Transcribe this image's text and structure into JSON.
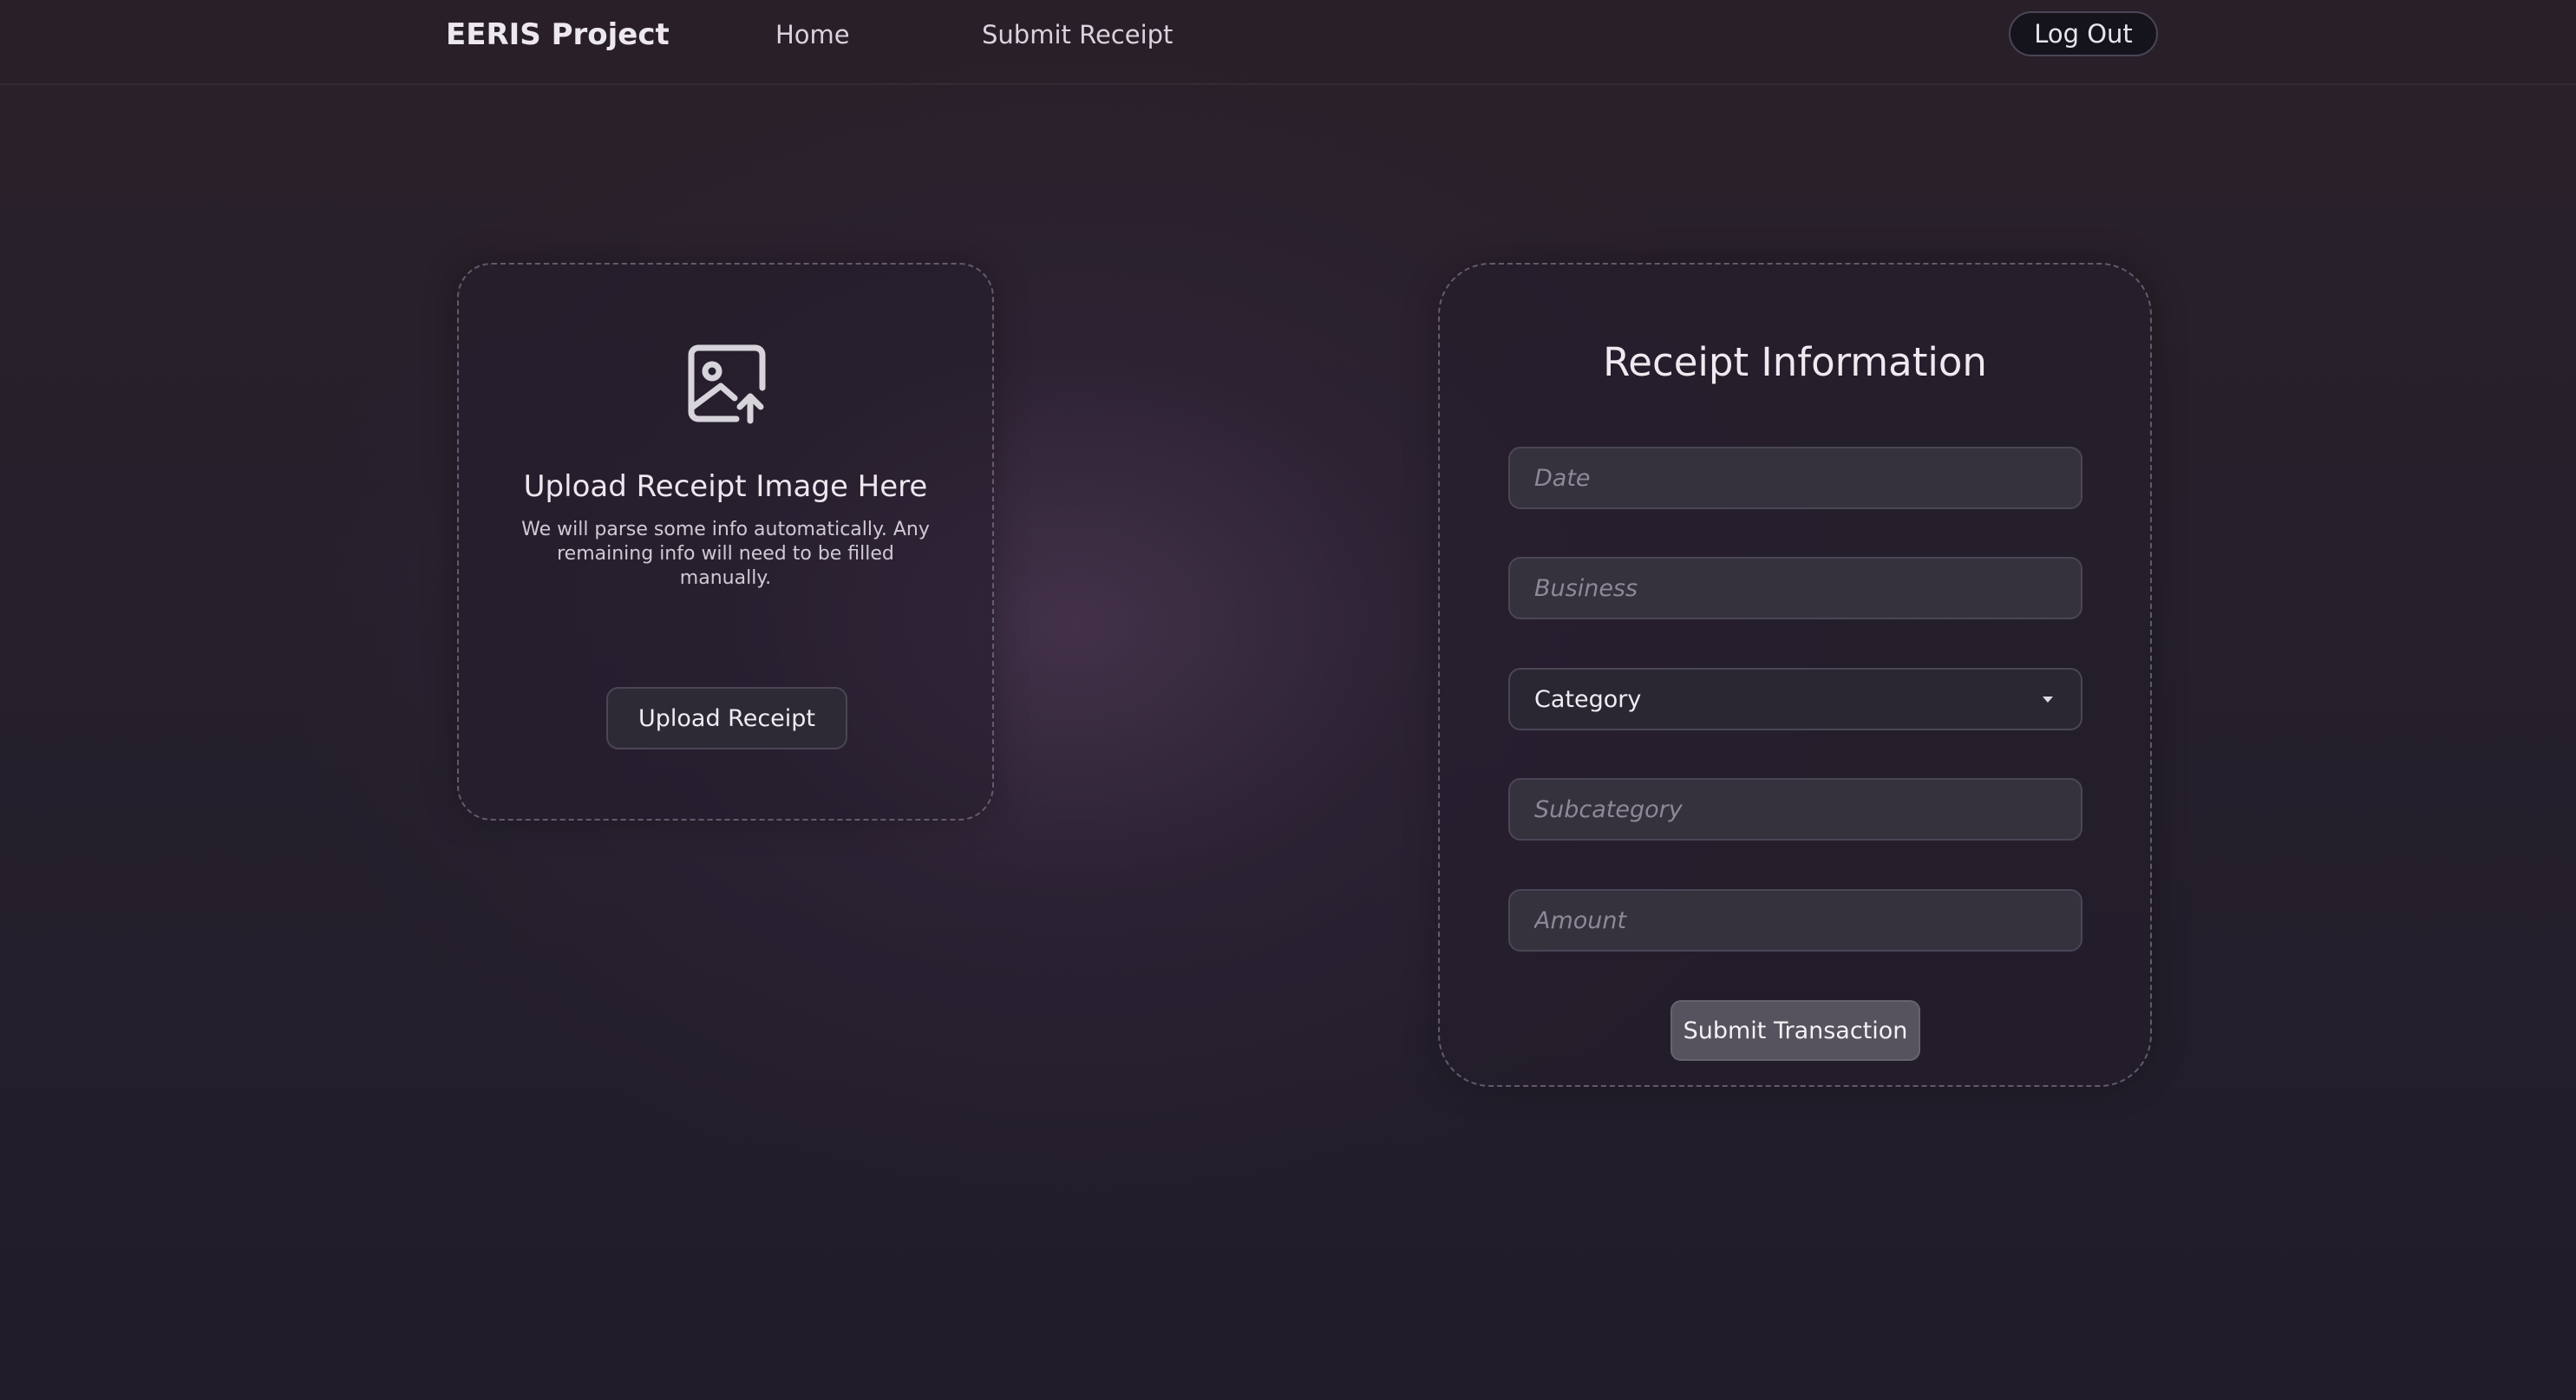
{
  "nav": {
    "brand": "EERIS Project",
    "links": [
      {
        "label": "Home"
      },
      {
        "label": "Submit Receipt"
      }
    ],
    "logout_label": "Log Out"
  },
  "upload": {
    "icon": "image-upload-icon",
    "title": "Upload Receipt Image Here",
    "description": "We will parse some info automatically. Any remaining info will need to be filled manually.",
    "button_label": "Upload Receipt"
  },
  "receipt_form": {
    "title": "Receipt Information",
    "date_placeholder": "Date",
    "business_placeholder": "Business",
    "category_selected": "Category",
    "subcategory_placeholder": "Subcategory",
    "amount_placeholder": "Amount",
    "submit_label": "Submit Transaction"
  },
  "colors": {
    "background": "#241e2a",
    "card_border": "#968ca0",
    "submit_button": "#57535e"
  }
}
